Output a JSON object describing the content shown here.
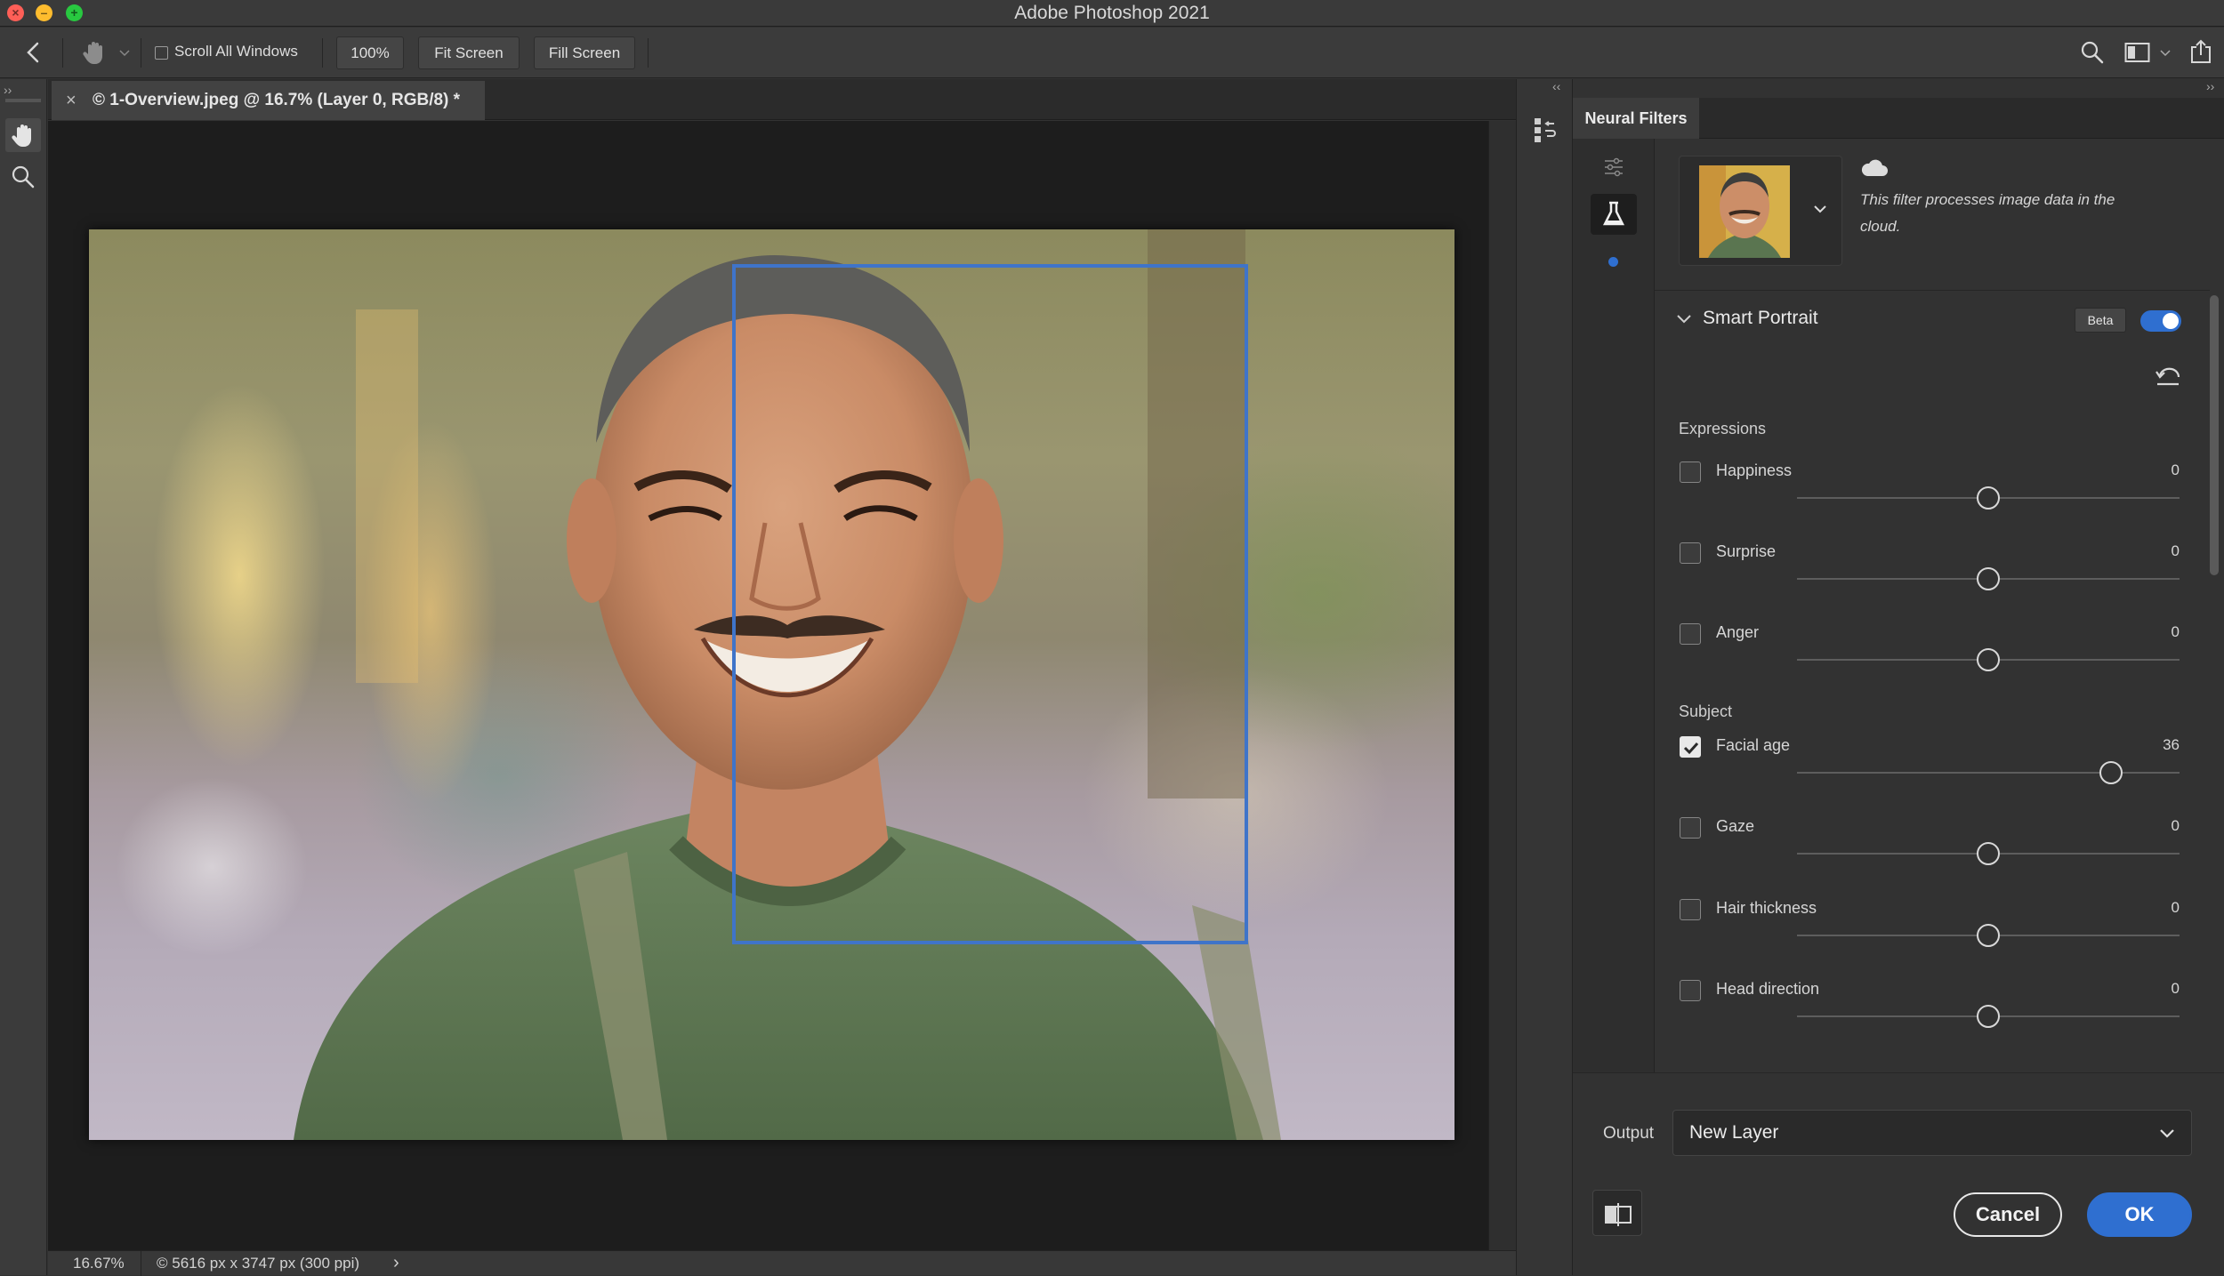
{
  "window": {
    "title": "Adobe Photoshop 2021"
  },
  "options_bar": {
    "scroll_all_windows_label": "Scroll All Windows",
    "zoom_button": "100%",
    "fit_screen_button": "Fit Screen",
    "fill_screen_button": "Fill Screen"
  },
  "document": {
    "tab_title": "© 1-Overview.jpeg @ 16.7% (Layer 0, RGB/8) *",
    "close_glyph": "×"
  },
  "status_bar": {
    "zoom": "16.67%",
    "doc_info": "© 5616 px x 3747 px (300 ppi)",
    "arrow": "›"
  },
  "neural_filters": {
    "panel_tab": "Neural Filters",
    "cloud_notice": "This filter processes image data in the cloud.",
    "filter_name": "Smart Portrait",
    "beta_badge": "Beta",
    "enabled": true,
    "sections": {
      "expressions": "Expressions",
      "subject": "Subject"
    },
    "sliders": [
      {
        "label": "Happiness",
        "value": "0",
        "checked": false,
        "fraction": 0.5
      },
      {
        "label": "Surprise",
        "value": "0",
        "checked": false,
        "fraction": 0.5
      },
      {
        "label": "Anger",
        "value": "0",
        "checked": false,
        "fraction": 0.5
      },
      {
        "label": "Facial age",
        "value": "36",
        "checked": true,
        "fraction": 0.82
      },
      {
        "label": "Gaze",
        "value": "0",
        "checked": false,
        "fraction": 0.5
      },
      {
        "label": "Hair thickness",
        "value": "0",
        "checked": false,
        "fraction": 0.5
      },
      {
        "label": "Head direction",
        "value": "0",
        "checked": false,
        "fraction": 0.5
      }
    ],
    "output_label": "Output",
    "output_value": "New Layer",
    "cancel_button": "Cancel",
    "ok_button": "OK"
  },
  "colors": {
    "accent": "#2f6fd0",
    "face_box": "#3f74c9",
    "shirt": "#5e7652"
  },
  "icons": [
    "back-icon",
    "hand-tool-icon",
    "zoom-tool-icon",
    "search-icon",
    "workspace-icon",
    "share-icon",
    "cloud-icon",
    "reset-icon",
    "flask-icon",
    "sliders-icon",
    "compare-icon",
    "chevron-down-icon"
  ]
}
